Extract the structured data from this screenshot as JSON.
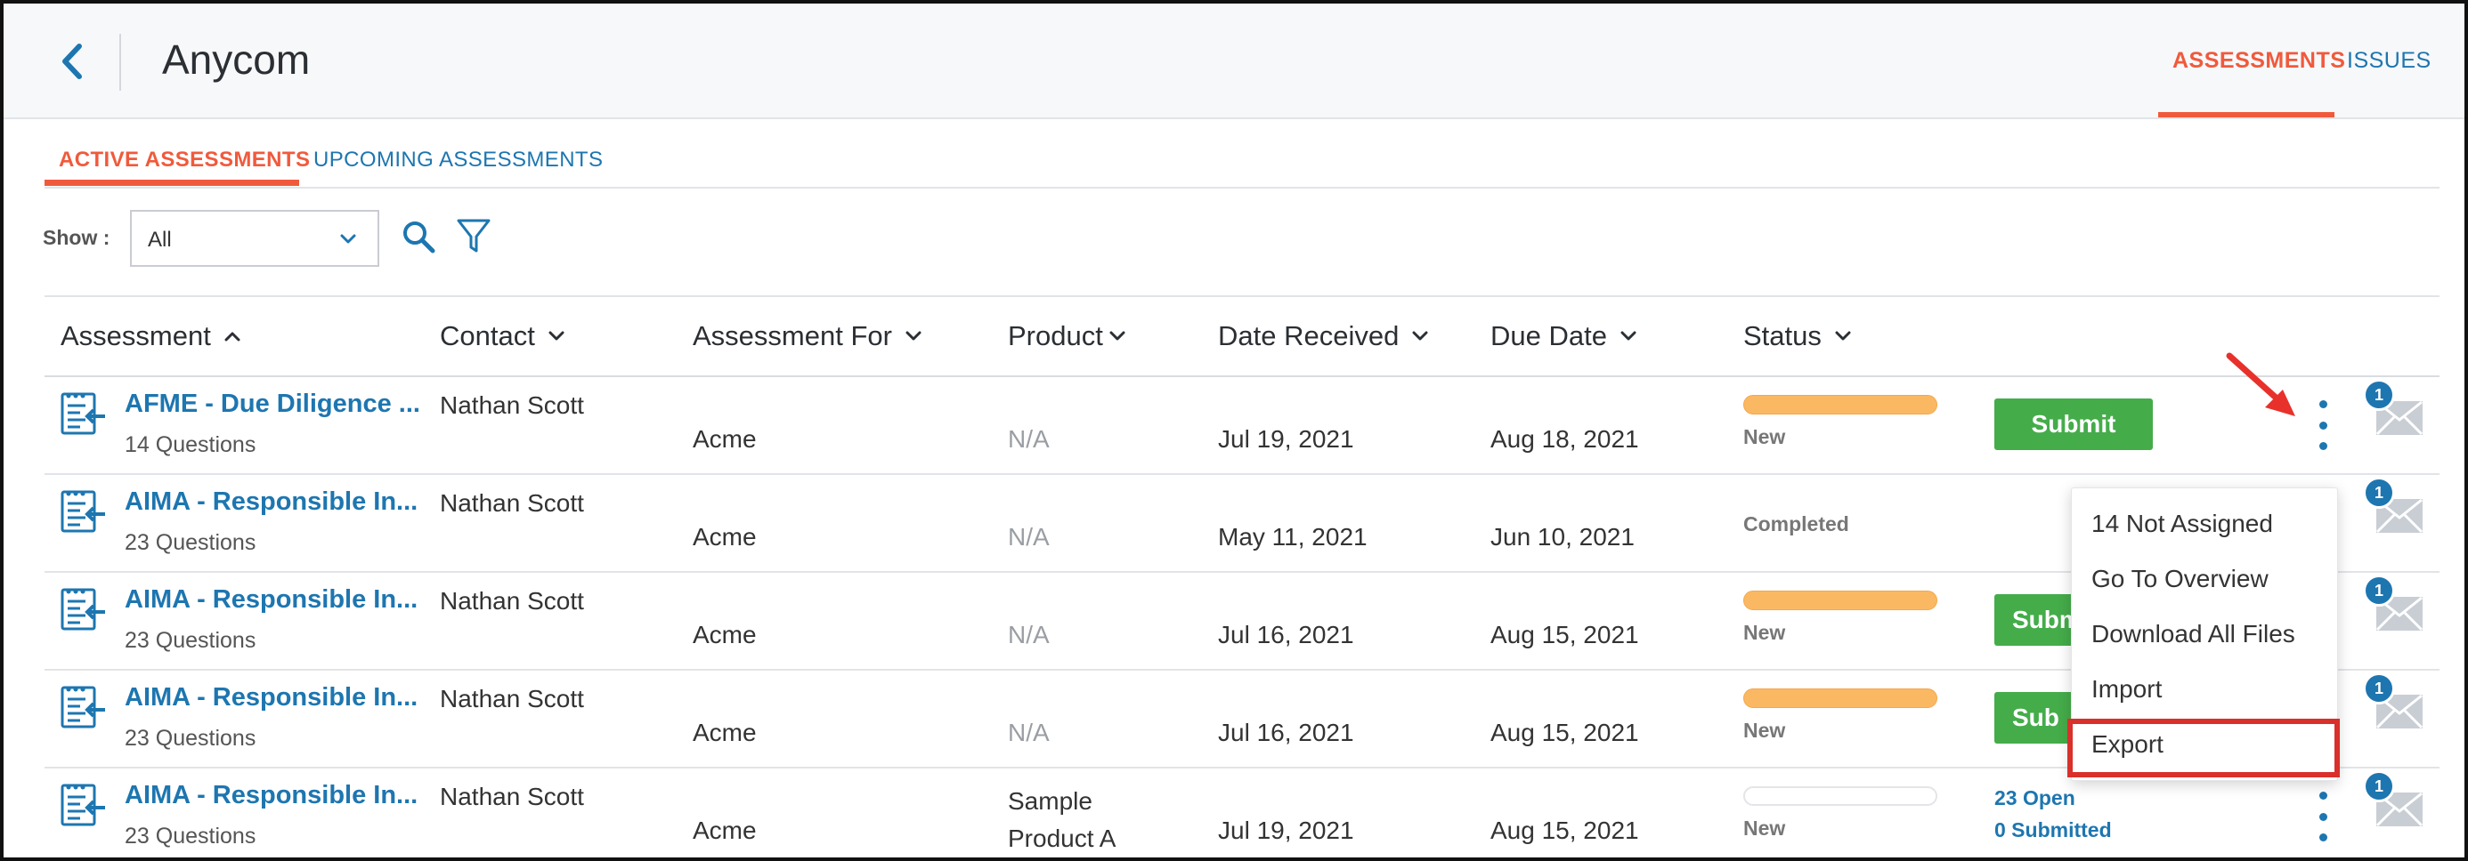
{
  "header": {
    "title": "Anycom",
    "tabs": [
      {
        "label": "ASSESSMENTS",
        "active": true
      },
      {
        "label": "ISSUES",
        "active": false
      }
    ]
  },
  "subtabs": [
    {
      "label": "ACTIVE ASSESSMENTS",
      "active": true
    },
    {
      "label": "UPCOMING ASSESSMENTS",
      "active": false
    }
  ],
  "filters": {
    "show_label": "Show :",
    "show_value": "All"
  },
  "columns": [
    "Assessment",
    "Contact",
    "Assessment For",
    "Product",
    "Date Received",
    "Due Date",
    "Status"
  ],
  "rows": [
    {
      "title": "AFME - Due Diligence ...",
      "questions": "14 Questions",
      "contact": "Nathan Scott",
      "for": "Acme",
      "product": "N/A",
      "received": "Jul 19, 2021",
      "due": "Aug 18, 2021",
      "status": "New",
      "progress": 1.0,
      "action": "Submit",
      "badge": "1"
    },
    {
      "title": "AIMA - Responsible In...",
      "questions": "23 Questions",
      "contact": "Nathan Scott",
      "for": "Acme",
      "product": "N/A",
      "received": "May 11, 2021",
      "due": "Jun 10, 2021",
      "status": "Completed",
      "badge": "1"
    },
    {
      "title": "AIMA - Responsible In...",
      "questions": "23 Questions",
      "contact": "Nathan Scott",
      "for": "Acme",
      "product": "N/A",
      "received": "Jul 16, 2021",
      "due": "Aug 15, 2021",
      "status": "New",
      "progress": 1.0,
      "action": "Subm",
      "badge": "1"
    },
    {
      "title": "AIMA - Responsible In...",
      "questions": "23 Questions",
      "contact": "Nathan Scott",
      "for": "Acme",
      "product": "N/A",
      "received": "Jul 16, 2021",
      "due": "Aug 15, 2021",
      "status": "New",
      "progress": 1.0,
      "action": "Sub",
      "badge": "1"
    },
    {
      "title": "AIMA - Responsible In...",
      "questions": "23 Questions",
      "contact": "Nathan Scott",
      "for": "Acme",
      "product_line1": "Sample",
      "product_line2": "Product A",
      "received": "Jul 19, 2021",
      "due": "Aug 15, 2021",
      "status": "New",
      "progress": 0.0,
      "open_link": "23 Open",
      "submitted_link": "0 Submitted",
      "badge": "1"
    }
  ],
  "menu": {
    "items": [
      "14 Not Assigned",
      "Go To Overview",
      "Download All Files",
      "Import",
      "Export"
    ],
    "highlighted": "Export"
  },
  "colors": {
    "accent": "#f05a3c",
    "link": "#1d76b0",
    "submit": "#45ac4a",
    "progress": "#fbb862",
    "highlight_box": "#d9302b"
  }
}
